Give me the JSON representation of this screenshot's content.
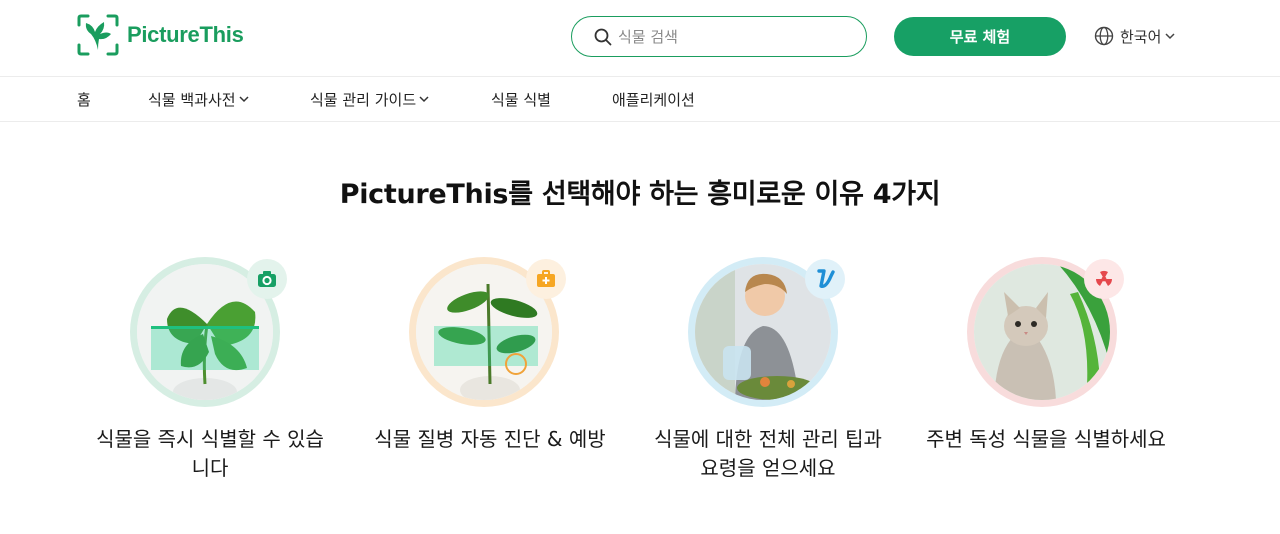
{
  "brand": {
    "name": "PictureThis",
    "color": "#1a9d5e"
  },
  "header": {
    "search": {
      "placeholder": "식물 검색",
      "icon": "search-icon"
    },
    "cta_label": "무료 체험",
    "language": {
      "label": "한국어",
      "icon": "globe-icon"
    }
  },
  "nav": {
    "items": [
      {
        "label": "홈",
        "dropdown": false
      },
      {
        "label": "식물 백과사전",
        "dropdown": true
      },
      {
        "label": "식물 관리 가이드",
        "dropdown": true
      },
      {
        "label": "식물 식별",
        "dropdown": false
      },
      {
        "label": "애플리케이션",
        "dropdown": false
      }
    ]
  },
  "main": {
    "heading": "PictureThis를 선택해야 하는 흥미로운 이유 4가지",
    "features": [
      {
        "label_line1": "식물을 즉시 식별할 수 있습",
        "label_line2": "니다",
        "badge_icon": "camera-icon",
        "ring_color": "#d6eee3"
      },
      {
        "label_line1": "식물 질병 자동 진단 & 예방",
        "label_line2": "",
        "badge_icon": "first-aid-kit-icon",
        "ring_color": "#fbe6cc"
      },
      {
        "label_line1": "식물에 대한 전체 관리 팁과",
        "label_line2": "요령을 얻으세요",
        "badge_icon": "watering-icon",
        "ring_color": "#d3ecf6"
      },
      {
        "label_line1": "주변 독성 식물을 식별하세요",
        "label_line2": "",
        "badge_icon": "toxic-icon",
        "ring_color": "#f8dcdc"
      }
    ]
  }
}
